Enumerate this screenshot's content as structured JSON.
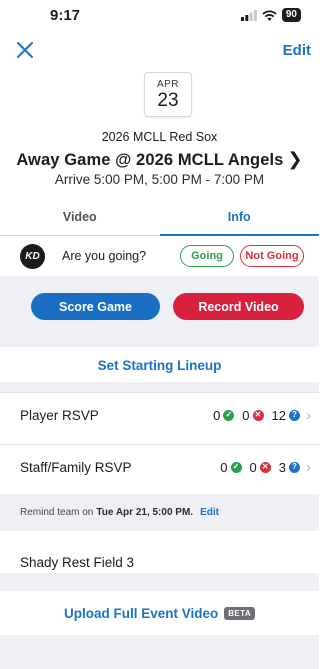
{
  "status_bar": {
    "time": "9:17",
    "battery": "90"
  },
  "nav": {
    "edit_label": "Edit"
  },
  "event": {
    "month": "APR",
    "day": "23",
    "team": "2026 MCLL Red Sox",
    "title": "Away Game @ 2026 MCLL Angels",
    "arrive": "Arrive 5:00 PM, 5:00 PM - 7:00 PM"
  },
  "tabs": [
    {
      "label": "Video",
      "active": false
    },
    {
      "label": "Info",
      "active": true
    }
  ],
  "rsvp": {
    "avatar_initials": "KD",
    "question": "Are you going?",
    "going_label": "Going",
    "not_going_label": "Not Going"
  },
  "actions": {
    "score_label": "Score Game",
    "record_label": "Record Video"
  },
  "lineup_label": "Set Starting Lineup",
  "player_rsvp": {
    "label": "Player RSVP",
    "going": "0",
    "not_going": "0",
    "unknown": "12"
  },
  "staff_rsvp": {
    "label": "Staff/Family RSVP",
    "going": "0",
    "not_going": "0",
    "unknown": "3"
  },
  "remind": {
    "prefix": "Remind team on",
    "datetime": "Tue Apr 21, 5:00 PM.",
    "edit_label": "Edit"
  },
  "location": "Shady Rest Field 3",
  "upload": {
    "label": "Upload Full Event Video",
    "badge": "BETA"
  },
  "colors": {
    "accent": "#1a73c8",
    "going": "#2e9e4f",
    "not_going": "#d9303d",
    "record": "#d8213f",
    "score": "#1a6fc4",
    "band": "#eef0f6"
  }
}
